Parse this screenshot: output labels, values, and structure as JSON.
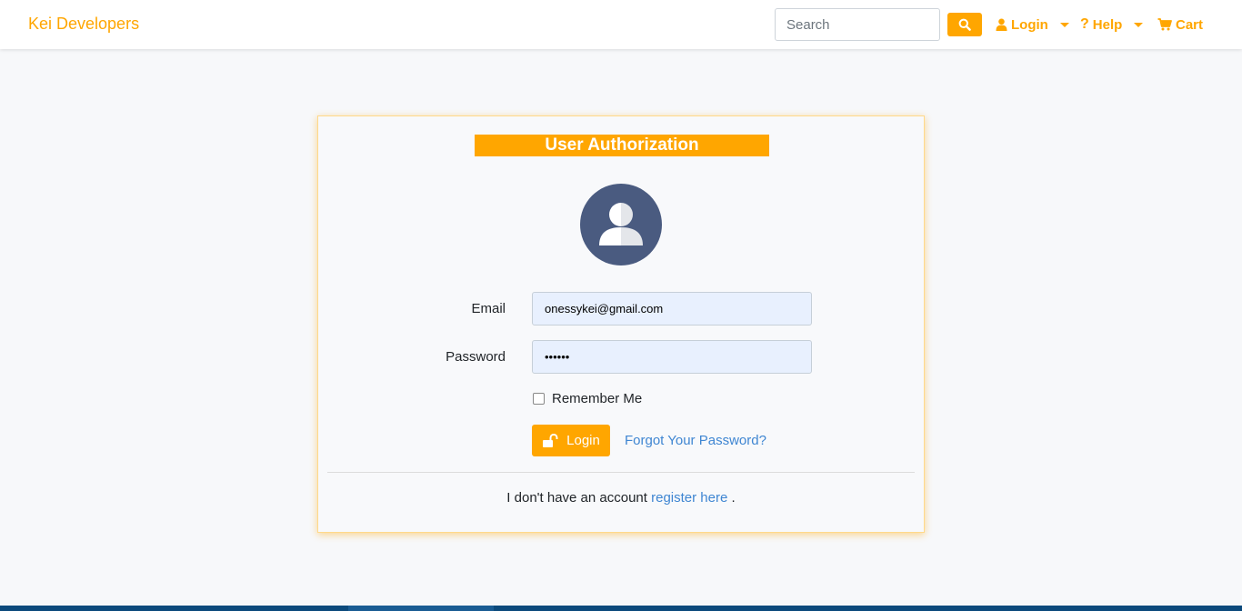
{
  "navbar": {
    "brand": "Kei Developers",
    "search_placeholder": "Search",
    "login_label": "Login",
    "help_label": "Help",
    "cart_label": "Cart",
    "accent_color": "#ffa600"
  },
  "card": {
    "title": "User Authorization",
    "avatar_icon": "user-avatar-icon",
    "email_label": "Email",
    "email_value": "onessykei@gmail.com",
    "password_label": "Password",
    "password_value": "123456",
    "remember_label": "Remember Me",
    "remember_checked": false,
    "login_button_label": "Login",
    "forgot_label": "Forgot Your Password?",
    "register_prefix": "I don't have an account",
    "register_link": "register here",
    "register_suffix": "."
  },
  "colors": {
    "accent": "#ffa600",
    "link": "#3f86d2",
    "avatar_bg": "#4a5b80",
    "input_bg": "#e8f0fe"
  }
}
